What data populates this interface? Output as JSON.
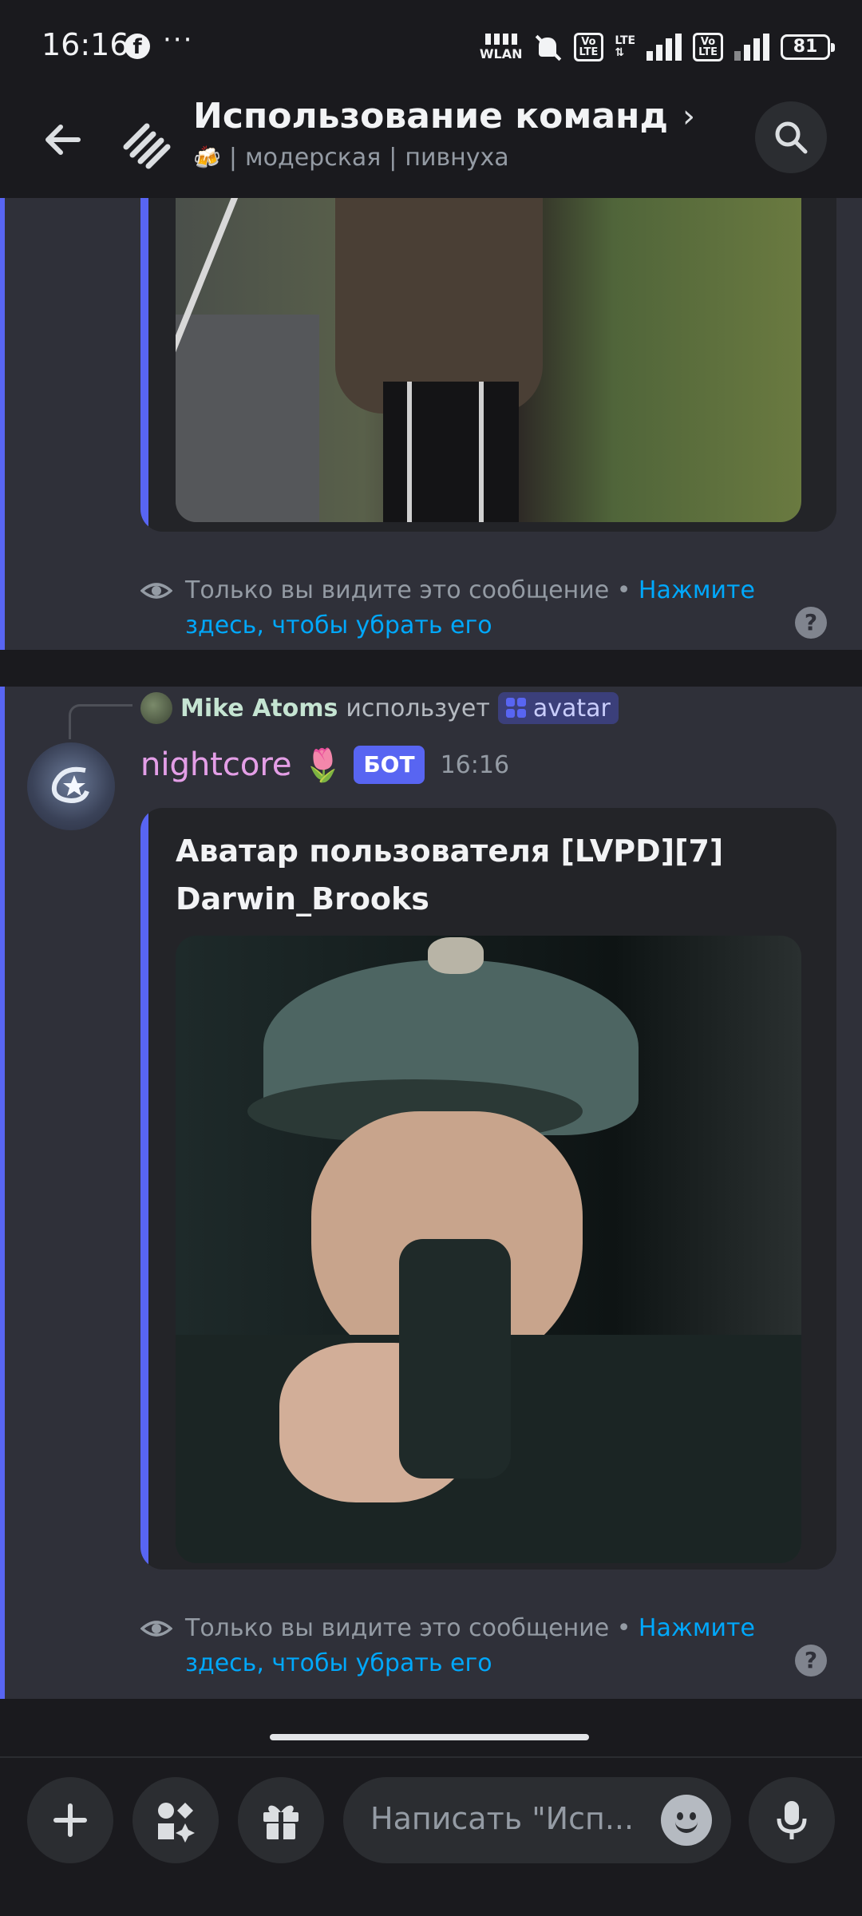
{
  "status": {
    "time": "16:16",
    "wlan": "WLAN",
    "volte1": "Vo\nLTE",
    "lte": "LTE",
    "volte2": "Vo\nLTE",
    "battery": "81"
  },
  "header": {
    "title": "Использование команд",
    "subtitle_emoji": "🍻",
    "subtitle_parts": [
      "модерская",
      "пивнуха"
    ]
  },
  "messages": [
    {
      "ephemeral": {
        "text": "Только вы видите это сообщение • ",
        "link": "Нажмите здесь, чтобы убрать его",
        "help": "?"
      }
    },
    {
      "reply": {
        "user": "Mike Atoms",
        "verb": "использует",
        "command": "avatar"
      },
      "author": {
        "name": "nightcore",
        "badge_emoji": "🌷",
        "tag": "БОТ",
        "time": "16:16"
      },
      "embed": {
        "title": "Аватар пользователя [LVPD][7] Darwin_Brooks"
      },
      "ephemeral": {
        "text": "Только вы видите это сообщение • ",
        "link": "Нажмите здесь, чтобы убрать его",
        "help": "?"
      }
    }
  ],
  "composer": {
    "placeholder": "Написать \"Исп..."
  },
  "icons": {
    "back": "arrow-left-icon",
    "channel": "thread-icon",
    "search": "search-icon",
    "plus": "plus-icon",
    "apps": "apps-icon",
    "gift": "gift-icon",
    "emoji": "emoji-icon",
    "mic": "microphone-icon",
    "eye": "eye-icon"
  },
  "colors": {
    "accent": "#5865f2",
    "link": "#00a8fc",
    "background": "#1a1a1e",
    "message_bg": "#2f3039"
  }
}
